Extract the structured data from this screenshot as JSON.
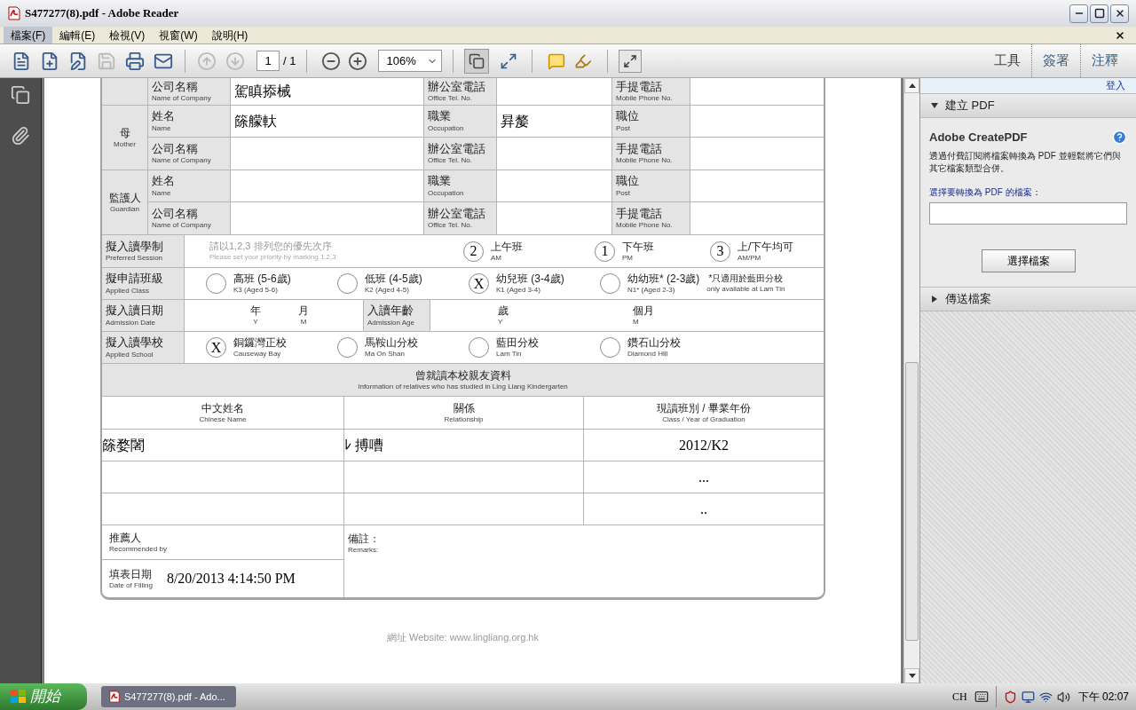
{
  "window": {
    "title": "S477277(8).pdf - Adobe Reader"
  },
  "menu": [
    {
      "label": "檔案(F)",
      "selected": true
    },
    {
      "label": "編輯(E)",
      "selected": false
    },
    {
      "label": "檢視(V)",
      "selected": false
    },
    {
      "label": "視窗(W)",
      "selected": false
    },
    {
      "label": "說明(H)",
      "selected": false
    }
  ],
  "toolbar": {
    "buttons": [
      {
        "kind": "open",
        "disabled": false
      },
      {
        "kind": "create",
        "disabled": false
      },
      {
        "kind": "edit",
        "disabled": false
      },
      {
        "kind": "save",
        "disabled": true
      },
      {
        "kind": "print",
        "disabled": false
      },
      {
        "kind": "mail",
        "disabled": false
      },
      {
        "kind": "prev",
        "disabled": true
      },
      {
        "kind": "next",
        "disabled": true
      }
    ],
    "page": "1",
    "page_total": "/ 1",
    "zoom": "106%",
    "panel_tabs": [
      "工具",
      "簽署",
      "注釋"
    ]
  },
  "form": {
    "parent_groups": [
      {
        "rows": [
          [
            {
              "zh": "公司名稱",
              "en": "Name of Company",
              "value": "駕瞋掭械"
            },
            {
              "zh": "辦公室電話",
              "en": "Office Tel. No."
            },
            {
              "zh": "手提電話",
              "en": "Mobile Phone No."
            }
          ]
        ]
      },
      {
        "zh": "母",
        "en": "Mother",
        "rows": [
          [
            {
              "zh": "姓名",
              "en": "Name",
              "value": "篨艨軑"
            },
            {
              "zh": "職業",
              "en": "Occupation",
              "value": "昪嫠"
            },
            {
              "zh": "職位",
              "en": "Post"
            }
          ],
          [
            {
              "zh": "公司名稱",
              "en": "Name of Company"
            },
            {
              "zh": "辦公室電話",
              "en": "Office Tel. No."
            },
            {
              "zh": "手提電話",
              "en": "Mobile Phone No."
            }
          ]
        ]
      },
      {
        "zh": "監護人",
        "en": "Guardian",
        "rows": [
          [
            {
              "zh": "姓名",
              "en": "Name"
            },
            {
              "zh": "職業",
              "en": "Occupation"
            },
            {
              "zh": "職位",
              "en": "Post"
            }
          ],
          [
            {
              "zh": "公司名稱",
              "en": "Name of Company"
            },
            {
              "zh": "辦公室電話",
              "en": "Office Tel. No."
            },
            {
              "zh": "手提電話",
              "en": "Mobile Phone No."
            }
          ]
        ]
      }
    ],
    "session": {
      "zh": "擬入讀學制",
      "en": "Preferred Session",
      "hint_zh": "請以1,2,3 排列您的優先次序",
      "hint_en": "Please set your priority by marking 1,2,3",
      "options": [
        {
          "mark": "2",
          "zh": "上午班",
          "en": "AM"
        },
        {
          "mark": "1",
          "zh": "下午班",
          "en": "PM"
        },
        {
          "mark": "3",
          "zh": "上/下午均可",
          "en": "AM/PM"
        }
      ]
    },
    "applied_class": {
      "zh": "擬申請班級",
      "en": "Applied Class",
      "options": [
        {
          "zh": "高班 (5-6歲)",
          "en": "K3 (Aged 5-6)"
        },
        {
          "zh": "低班 (4-5歲)",
          "en": "K2 (Aged 4-5)"
        },
        {
          "mark": "X",
          "zh": "幼兒班 (3-4歲)",
          "en": "K1 (Aged 3-4)"
        },
        {
          "zh": "幼幼班* (2-3歲)",
          "en": "N1* (Aged 2-3)"
        }
      ],
      "note_zh": "*只適用於藍田分校",
      "note_en": "only available at Lam Tin"
    },
    "admission": {
      "date_zh": "擬入讀日期",
      "date_en": "Admission Date",
      "units_date": [
        {
          "zh": "年",
          "en": "Y"
        },
        {
          "zh": "月",
          "en": "M"
        }
      ],
      "age_zh": "入讀年齡",
      "age_en": "Admission Age",
      "units_age": [
        {
          "zh": "歲",
          "en": "Y"
        },
        {
          "zh": "個月",
          "en": "M"
        }
      ]
    },
    "school": {
      "zh": "擬入讀學校",
      "en": "Applied School",
      "options": [
        {
          "mark": "X",
          "zh": "銅鑼灣正校",
          "en": "Causeway Bay"
        },
        {
          "zh": "馬鞍山分校",
          "en": "Ma On Shan"
        },
        {
          "zh": "藍田分校",
          "en": "Lam Tin"
        },
        {
          "zh": "鑽石山分校",
          "en": "Diamond Hill"
        }
      ]
    },
    "relatives": {
      "zh": "曾就讀本校親友資料",
      "en": "Information of relatives who has studied in Ling Liang Kindergarten",
      "columns": [
        {
          "zh": "中文姓名",
          "en": "Chinese Name"
        },
        {
          "zh": "關係",
          "en": "Relationship"
        },
        {
          "zh": "現讀班別 / 畢業年份",
          "en": "Class / Year of Graduation"
        }
      ],
      "rows": [
        [
          "篨婺闍",
          "ﾚ 搏嘈",
          "2012/K2"
        ],
        [
          null,
          null,
          "..."
        ],
        [
          null,
          null,
          ".."
        ]
      ]
    },
    "recommended": {
      "zh": "推薦人",
      "en": "Recommended by"
    },
    "filled": {
      "zh": "填表日期",
      "en": "Date of Filling",
      "value": "8/20/2013 4:14:50 PM"
    },
    "remarks": {
      "zh": "備註：",
      "en": "Remarks:"
    },
    "website": "網址 Website: www.lingliang.org.hk"
  },
  "side_panel": {
    "sign_in": "登入",
    "sections": [
      {
        "title": "建立 PDF",
        "expanded": true,
        "heading": "Adobe CreatePDF",
        "description": "透過付費訂閱將檔案轉換為 PDF 並輕鬆將它們與其它檔案類型合併。",
        "field_label": "選擇要轉換為 PDF 的檔案：",
        "button": "選擇檔案"
      },
      {
        "title": "傳送檔案",
        "expanded": false
      }
    ]
  },
  "taskbar": {
    "start": "開始",
    "tasks": [
      {
        "label": "S477277(8).pdf - Ado...",
        "selected": true
      }
    ],
    "language": "CH",
    "clock": "下午 02:07"
  }
}
